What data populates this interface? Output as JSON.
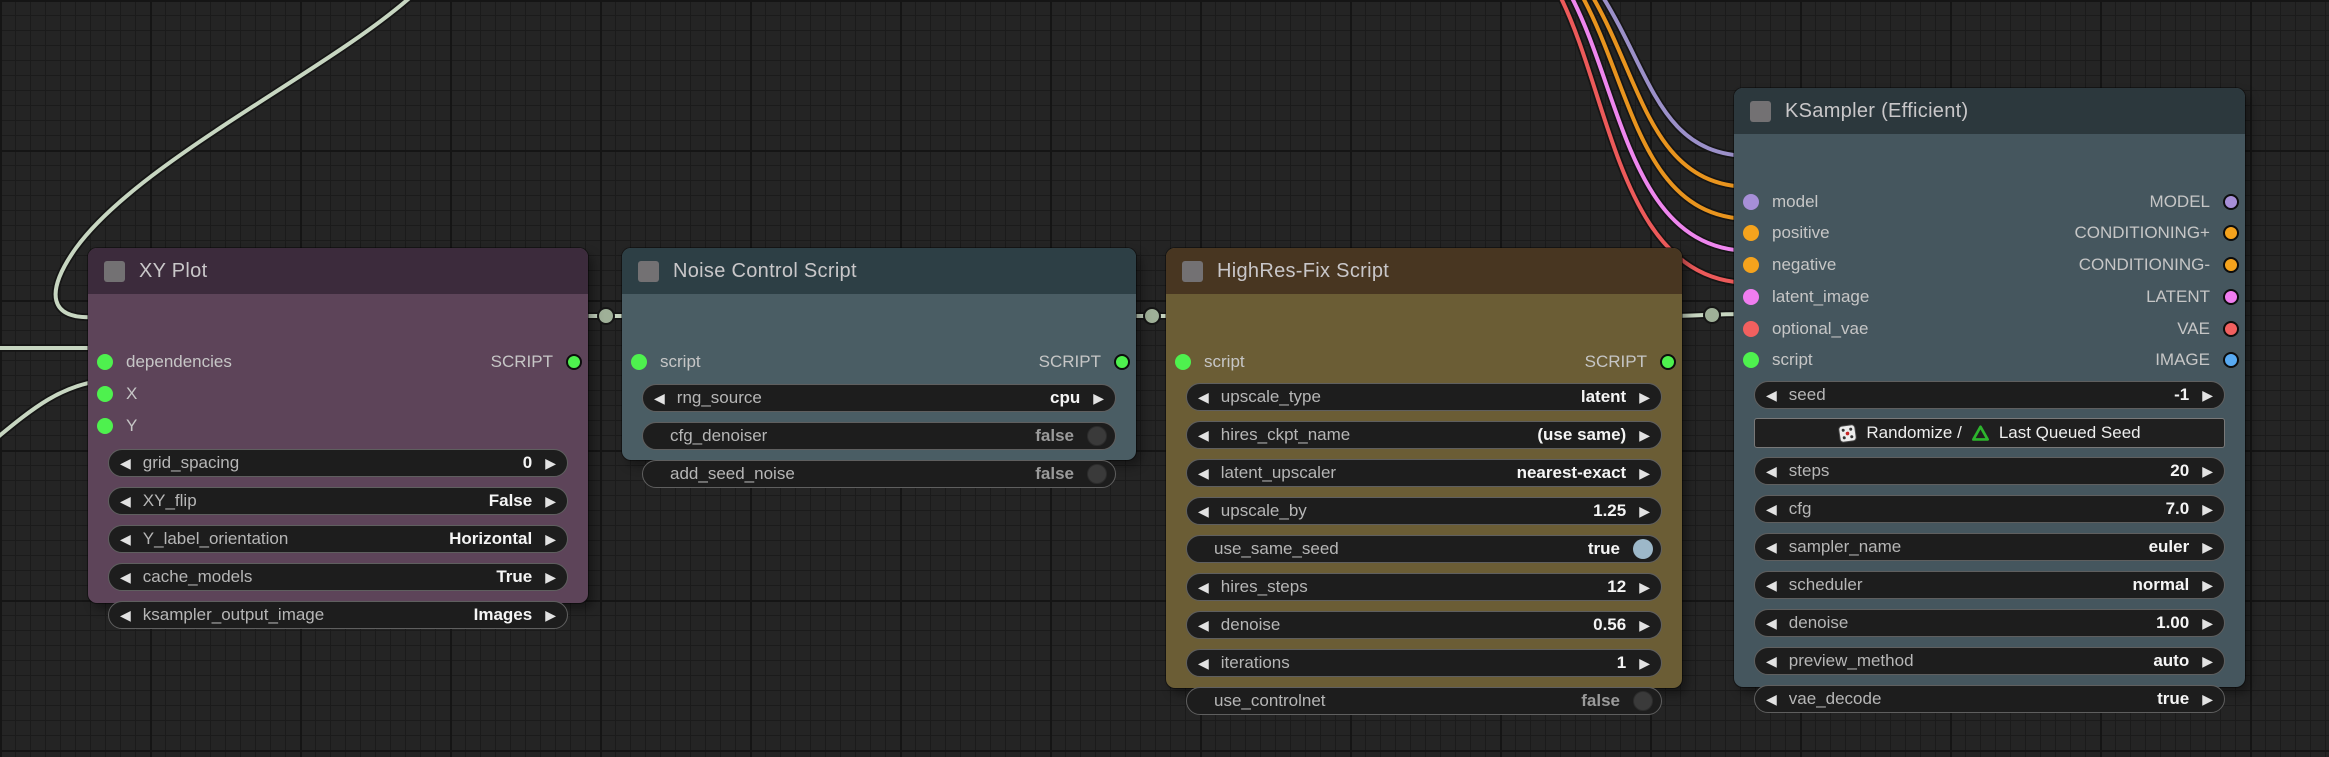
{
  "canvas": {
    "background_color": "#242424",
    "grid_minor_color": "#1b1b1b",
    "grid_major_color": "#151515"
  },
  "link_colors": {
    "script": "#c7d6c1",
    "model": "#9b90c9",
    "conditioning": "#e8941e",
    "latent": "#ee86ee",
    "vae": "#ec5a5a",
    "link_middle_dot": "#9fb098"
  },
  "port_colors": {
    "script_green": "#4ef14e",
    "model_purple": "#a78fd8",
    "conditioning_orange": "#f5a31d",
    "latent_pink": "#f07df0",
    "vae_red": "#f2605f",
    "image_blue": "#58aaf2"
  },
  "nodes": [
    {
      "title": "XY Plot",
      "header_color": "#3c2b3c",
      "body_color": "#5d4459",
      "inputs": [
        {
          "label": "dependencies"
        },
        {
          "label": "X"
        },
        {
          "label": "Y"
        }
      ],
      "outputs": [
        {
          "label": "SCRIPT"
        }
      ],
      "widgets": [
        {
          "type": "combo",
          "label": "grid_spacing",
          "value": "0"
        },
        {
          "type": "combo",
          "label": "XY_flip",
          "value": "False"
        },
        {
          "type": "combo",
          "label": "Y_label_orientation",
          "value": "Horizontal"
        },
        {
          "type": "combo",
          "label": "cache_models",
          "value": "True"
        },
        {
          "type": "combo",
          "label": "ksampler_output_image",
          "value": "Images"
        }
      ]
    },
    {
      "title": "Noise Control Script",
      "header_color": "#2d3f45",
      "body_color": "#4a5d64",
      "inputs": [
        {
          "label": "script"
        }
      ],
      "outputs": [
        {
          "label": "SCRIPT"
        }
      ],
      "widgets": [
        {
          "type": "combo",
          "label": "rng_source",
          "value": "cpu"
        },
        {
          "type": "toggle",
          "label": "cfg_denoiser",
          "value": "false",
          "state": "off"
        },
        {
          "type": "toggle",
          "label": "add_seed_noise",
          "value": "false",
          "state": "off"
        }
      ]
    },
    {
      "title": "HighRes-Fix Script",
      "header_color": "#483621",
      "body_color": "#6b5d35",
      "inputs": [
        {
          "label": "script"
        }
      ],
      "outputs": [
        {
          "label": "SCRIPT"
        }
      ],
      "widgets": [
        {
          "type": "combo",
          "label": "upscale_type",
          "value": "latent"
        },
        {
          "type": "combo",
          "label": "hires_ckpt_name",
          "value": "(use same)"
        },
        {
          "type": "combo",
          "label": "latent_upscaler",
          "value": "nearest-exact"
        },
        {
          "type": "combo",
          "label": "upscale_by",
          "value": "1.25"
        },
        {
          "type": "toggle",
          "label": "use_same_seed",
          "value": "true",
          "state": "on"
        },
        {
          "type": "combo",
          "label": "hires_steps",
          "value": "12"
        },
        {
          "type": "combo",
          "label": "denoise",
          "value": "0.56"
        },
        {
          "type": "combo",
          "label": "iterations",
          "value": "1"
        },
        {
          "type": "toggle",
          "label": "use_controlnet",
          "value": "false",
          "state": "off"
        }
      ]
    },
    {
      "title": "KSampler (Efficient)",
      "header_color": "#2c383d",
      "body_color": "#45565e",
      "inputs": [
        {
          "label": "model"
        },
        {
          "label": "positive"
        },
        {
          "label": "negative"
        },
        {
          "label": "latent_image"
        },
        {
          "label": "optional_vae"
        },
        {
          "label": "script"
        }
      ],
      "outputs": [
        {
          "label": "MODEL"
        },
        {
          "label": "CONDITIONING+"
        },
        {
          "label": "CONDITIONING-"
        },
        {
          "label": "LATENT"
        },
        {
          "label": "VAE"
        },
        {
          "label": "IMAGE"
        }
      ],
      "widgets": [
        {
          "type": "combo",
          "label": "seed",
          "value": "-1"
        },
        {
          "type": "button",
          "label_a": "Randomize /",
          "label_b": "Last Queued Seed",
          "icons": [
            "dice-icon",
            "recycle-icon"
          ]
        },
        {
          "type": "combo",
          "label": "steps",
          "value": "20"
        },
        {
          "type": "combo",
          "label": "cfg",
          "value": "7.0"
        },
        {
          "type": "combo",
          "label": "sampler_name",
          "value": "euler"
        },
        {
          "type": "combo",
          "label": "scheduler",
          "value": "normal"
        },
        {
          "type": "combo",
          "label": "denoise",
          "value": "1.00"
        },
        {
          "type": "combo",
          "label": "preview_method",
          "value": "auto"
        },
        {
          "type": "combo",
          "label": "vae_decode",
          "value": "true"
        }
      ]
    }
  ]
}
